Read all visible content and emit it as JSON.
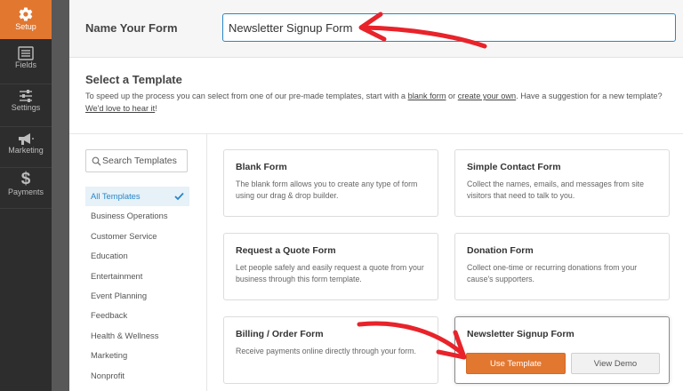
{
  "nav": {
    "items": [
      {
        "id": "setup",
        "label": "Setup",
        "icon": "gear-icon",
        "active": true
      },
      {
        "id": "fields",
        "label": "Fields",
        "icon": "list-icon",
        "active": false
      },
      {
        "id": "settings",
        "label": "Settings",
        "icon": "sliders-icon",
        "active": false
      },
      {
        "id": "marketing",
        "label": "Marketing",
        "icon": "megaphone-icon",
        "active": false
      },
      {
        "id": "payments",
        "label": "Payments",
        "icon": "dollar-icon",
        "active": false
      }
    ]
  },
  "form_name": {
    "label": "Name Your Form",
    "value": "Newsletter Signup Form"
  },
  "template_section": {
    "title": "Select a Template",
    "desc_before": "To speed up the process you can select from one of our pre-made templates, start with a ",
    "blank_link": "blank form",
    "desc_mid1": " or ",
    "own_link": "create your own",
    "desc_mid2": ". Have a suggestion for a new template? ",
    "hear_link": "We'd love to hear it",
    "desc_end": "!"
  },
  "search": {
    "placeholder": "Search Templates"
  },
  "categories": [
    {
      "label": "All Templates",
      "active": true
    },
    {
      "label": "Business Operations"
    },
    {
      "label": "Customer Service"
    },
    {
      "label": "Education"
    },
    {
      "label": "Entertainment"
    },
    {
      "label": "Event Planning"
    },
    {
      "label": "Feedback"
    },
    {
      "label": "Health & Wellness"
    },
    {
      "label": "Marketing"
    },
    {
      "label": "Nonprofit"
    }
  ],
  "templates": [
    {
      "title": "Blank Form",
      "desc": "The blank form allows you to create any type of form using our drag & drop builder."
    },
    {
      "title": "Simple Contact Form",
      "desc": "Collect the names, emails, and messages from site visitors that need to talk to you."
    },
    {
      "title": "Request a Quote Form",
      "desc": "Let people safely and easily request a quote from your business through this form template."
    },
    {
      "title": "Donation Form",
      "desc": "Collect one-time or recurring donations from your cause's supporters."
    },
    {
      "title": "Billing / Order Form",
      "desc": "Receive payments online directly through your form."
    },
    {
      "title": "Newsletter Signup Form",
      "desc": "",
      "use_label": "Use Template",
      "demo_label": "View Demo"
    }
  ],
  "colors": {
    "accent": "#e27730",
    "focus": "#2a86c7",
    "arrow": "#e8232a"
  }
}
